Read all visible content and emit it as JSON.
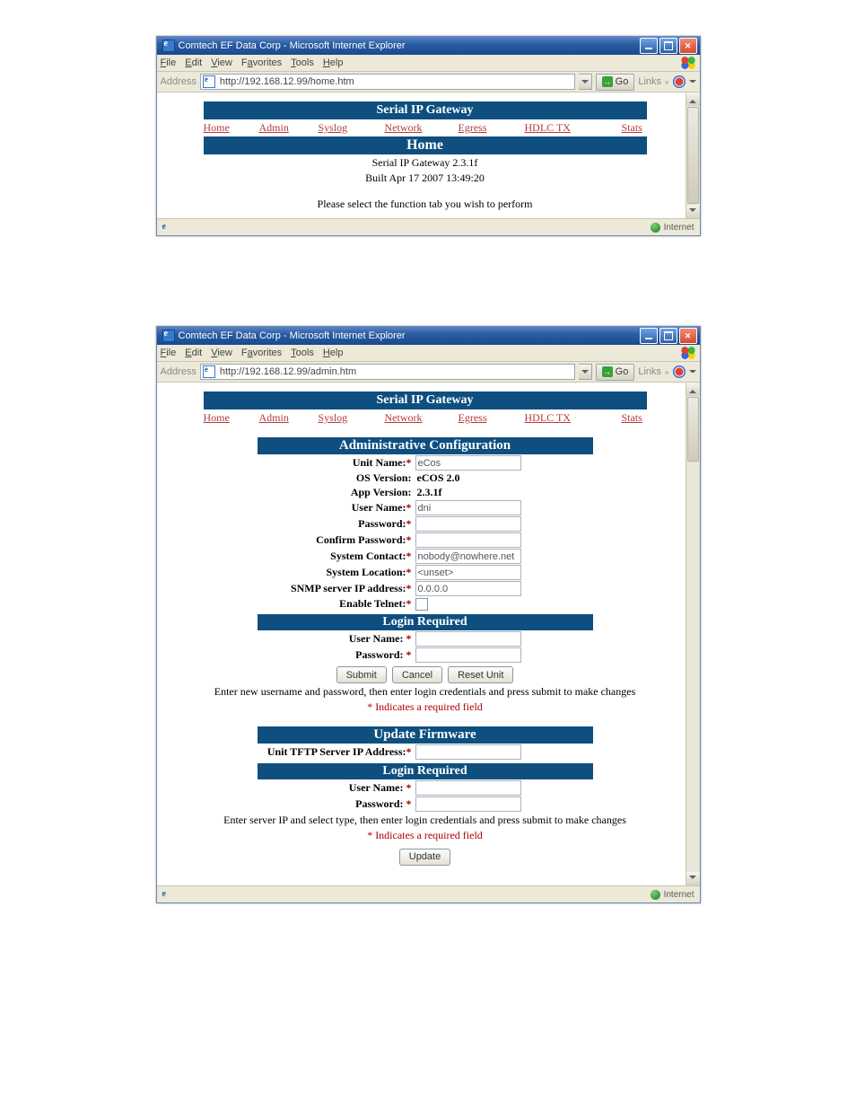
{
  "win1": {
    "title": "Comtech EF Data Corp - Microsoft Internet Explorer",
    "menus": {
      "file": "File",
      "edit": "Edit",
      "view": "View",
      "favorites": "Favorites",
      "tools": "Tools",
      "help": "Help"
    },
    "address_label": "Address",
    "url": "http://192.168.12.99/home.htm",
    "go": "Go",
    "links": "Links",
    "status_zone": "Internet",
    "page": {
      "banner": "Serial IP Gateway",
      "nav": {
        "home": "Home",
        "admin": "Admin",
        "syslog": "Syslog",
        "network": "Network",
        "egress": "Egress",
        "hdlctx": "HDLC TX",
        "stats": "Stats"
      },
      "title": "Home",
      "line1": "Serial IP Gateway 2.3.1f",
      "line2": "Built Apr 17 2007 13:49:20",
      "line3": "Please select the function tab you wish to perform"
    }
  },
  "win2": {
    "title": "Comtech EF Data Corp - Microsoft Internet Explorer",
    "menus": {
      "file": "File",
      "edit": "Edit",
      "view": "View",
      "favorites": "Favorites",
      "tools": "Tools",
      "help": "Help"
    },
    "address_label": "Address",
    "url": "http://192.168.12.99/admin.htm",
    "go": "Go",
    "links": "Links",
    "status_zone": "Internet",
    "page": {
      "banner": "Serial IP Gateway",
      "nav": {
        "home": "Home",
        "admin": "Admin",
        "syslog": "Syslog",
        "network": "Network",
        "egress": "Egress",
        "hdlctx": "HDLC TX",
        "stats": "Stats"
      },
      "admin_title": "Administrative Configuration",
      "fields": {
        "unit_name": {
          "label": "Unit Name:",
          "value": "eCos"
        },
        "os_version": {
          "label": "OS Version:",
          "value": "eCOS 2.0"
        },
        "app_version": {
          "label": "App Version:",
          "value": "2.3.1f"
        },
        "user_name": {
          "label": "User Name:",
          "value": "dni"
        },
        "password": {
          "label": "Password:",
          "value": ""
        },
        "confirm_password": {
          "label": "Confirm Password:",
          "value": ""
        },
        "system_contact": {
          "label": "System Contact:",
          "value": "nobody@nowhere.net"
        },
        "system_location": {
          "label": "System Location:",
          "value": "<unset>"
        },
        "snmp_ip": {
          "label": "SNMP server IP address:",
          "value": "0.0.0.0"
        },
        "enable_telnet": {
          "label": "Enable Telnet:"
        }
      },
      "login1": {
        "title": "Login Required",
        "user": {
          "label": "User Name: "
        },
        "pass": {
          "label": "Password: "
        },
        "submit": "Submit",
        "cancel": "Cancel",
        "reset": "Reset Unit",
        "note": "Enter new username and password, then enter login credentials and press submit to make changes",
        "req": "* Indicates a required field"
      },
      "fw": {
        "title": "Update Firmware",
        "tftp": {
          "label": "Unit TFTP Server IP Address:",
          "value": ""
        }
      },
      "login2": {
        "title": "Login Required",
        "user": {
          "label": "User Name: "
        },
        "pass": {
          "label": "Password: "
        },
        "note": "Enter server IP and select type, then enter login credentials and press submit to make changes",
        "req": "* Indicates a required field",
        "update": "Update"
      }
    }
  }
}
